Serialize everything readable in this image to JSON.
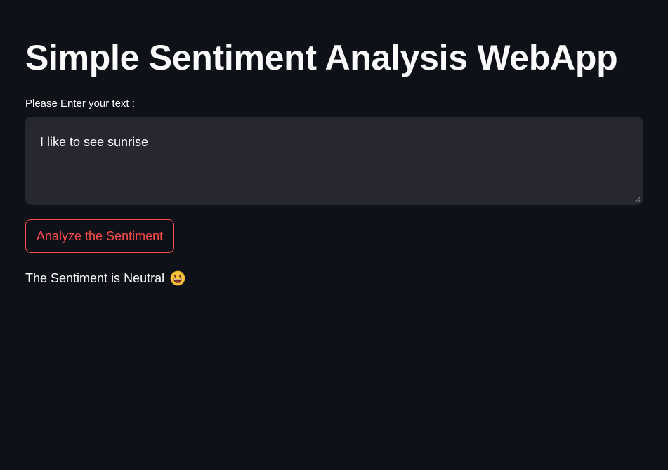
{
  "page": {
    "title": "Simple Sentiment Analysis WebApp"
  },
  "input": {
    "label": "Please Enter your text :",
    "value": "I like to see sunrise"
  },
  "button": {
    "label": "Analyze the Sentiment"
  },
  "result": {
    "text": "The Sentiment is Neutral",
    "icon": "grinning-face-emoji-icon"
  },
  "colors": {
    "background": "#0e1117",
    "input_background": "#262730",
    "accent": "#ff4b4b",
    "text": "#fafafa"
  }
}
